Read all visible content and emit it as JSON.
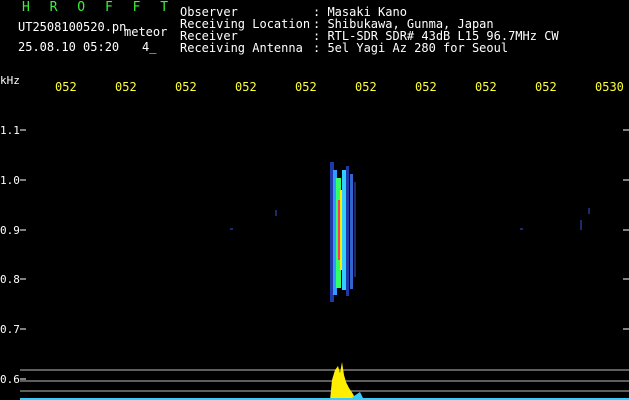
{
  "header": {
    "program": "H R O F F T",
    "file_name": "UT2508100520.pn",
    "file_suffix": "meteor",
    "date_time": "25.08.10 05:20",
    "page_indicator": "4_",
    "fields": [
      {
        "label": "Observer",
        "value": ": Masaki Kano"
      },
      {
        "label": "Receiving Location",
        "value": ": Shibukawa, Gunma, Japan"
      },
      {
        "label": "Receiver",
        "value": ": RTL-SDR SDR# 43dB L15 96.7MHz CW"
      },
      {
        "label": "Receiving Antenna",
        "value": ": 5el Yagi Az 280 for Seoul"
      }
    ]
  },
  "axes": {
    "y_unit": "kHz",
    "y_ticks": [
      "1.1",
      "1.0",
      "0.9",
      "0.8",
      "0.7",
      "0.6"
    ],
    "x_ticks": [
      "052",
      "052",
      "052",
      "052",
      "052",
      "052",
      "052",
      "052",
      "052",
      "0530"
    ]
  },
  "colors": {
    "background": "#000000",
    "tick_label": "#ffff33",
    "program_label": "#3df03d",
    "signal_hot": "#ff3366",
    "signal_warm": "#ffee00",
    "signal_cool": "#3399ff",
    "signal_green": "#33ff66"
  }
}
